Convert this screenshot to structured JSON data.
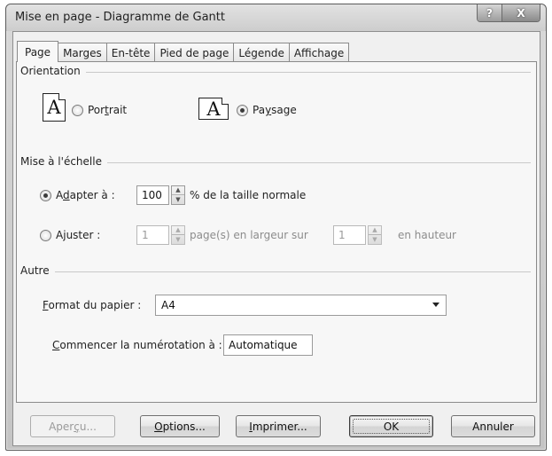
{
  "window": {
    "title": "Mise en page - Diagramme de Gantt",
    "help_label": "?",
    "close_label": "X"
  },
  "tabs": [
    {
      "label": "Page",
      "active": true
    },
    {
      "label": "Marges"
    },
    {
      "label": "En-tête"
    },
    {
      "label": "Pied de page"
    },
    {
      "label": "Légende"
    },
    {
      "label": "Affichage"
    }
  ],
  "orientation": {
    "group_label": "Orientation",
    "portrait": {
      "label_pre": "Por",
      "label_u": "t",
      "label_post": "rait",
      "checked": false,
      "icon": "page-portrait-icon",
      "icon_glyph": "A"
    },
    "landscape": {
      "label_pre": "Pa",
      "label_u": "y",
      "label_post": "sage",
      "checked": true,
      "icon": "page-landscape-icon",
      "icon_glyph": "A"
    }
  },
  "scaling": {
    "group_label": "Mise à l'échelle",
    "adjust_to": {
      "label_pre": "A",
      "label_u": "d",
      "label_post": "apter à :",
      "checked": true,
      "value": "100",
      "suffix": "% de la taille normale"
    },
    "fit_to": {
      "label_pre": "A",
      "label_u": "j",
      "label_post": "uster :",
      "checked": false,
      "wide_value": "1",
      "wide_suffix": "page(s) en largeur sur",
      "tall_value": "1",
      "tall_suffix": "en hauteur"
    }
  },
  "other": {
    "group_label": "Autre",
    "paper_size": {
      "label_u": "F",
      "label_post": "ormat du papier :",
      "value": "A4"
    },
    "first_page_number": {
      "label_u": "C",
      "label_post": "ommencer la numérotation à :",
      "value": "Automatique"
    }
  },
  "buttons": {
    "preview": {
      "label_pre": "Aper",
      "label_u": "ç",
      "label_post": "u..."
    },
    "options": {
      "label_u": "O",
      "label_post": "ptions..."
    },
    "print": {
      "label_u": "I",
      "label_post": "mprimer..."
    },
    "ok": {
      "label": "OK"
    },
    "cancel": {
      "label": "Annuler"
    }
  },
  "colors": {
    "dialog_background": "#f0f0f0",
    "title_bar": "#cdcdcd",
    "disabled_text": "#8c8c8c"
  }
}
